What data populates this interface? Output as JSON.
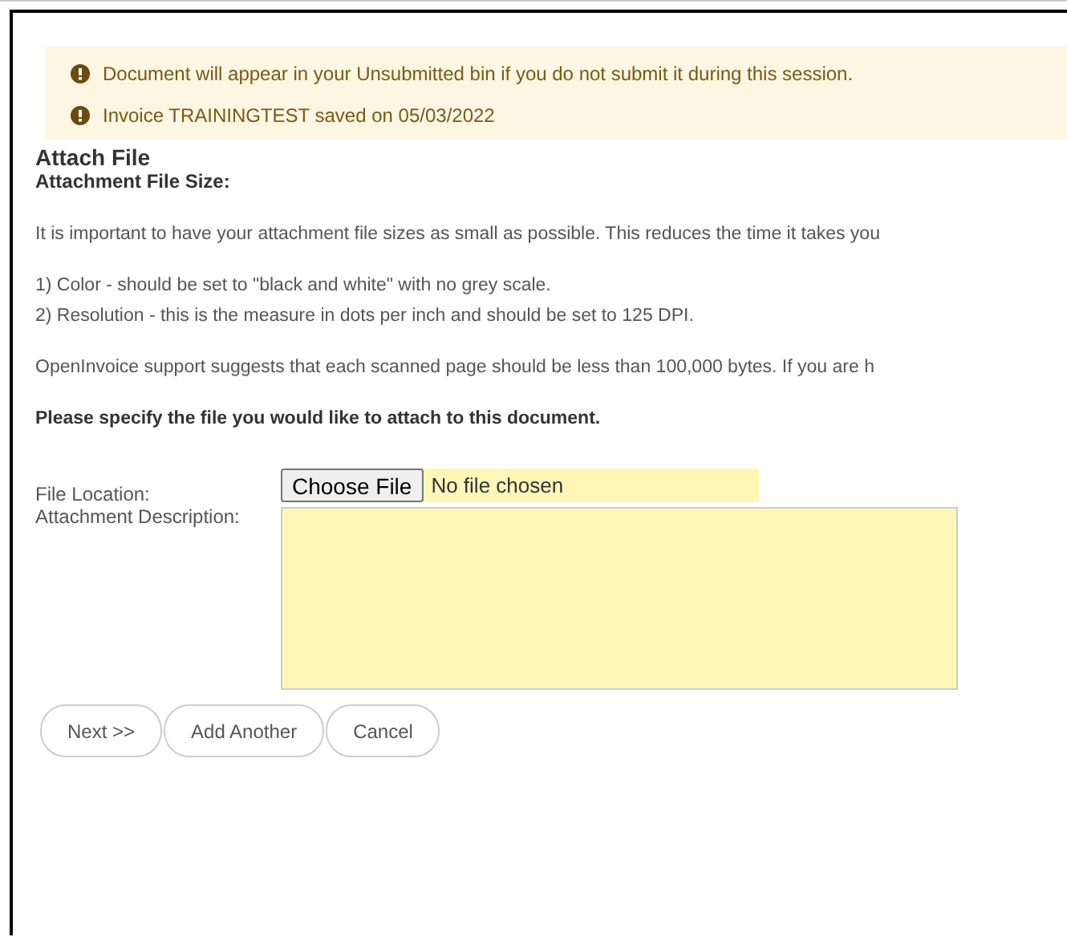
{
  "alerts": [
    "Document will appear in your Unsubmitted bin if you do not submit it during this session.",
    "Invoice TRAININGTEST saved on 05/03/2022"
  ],
  "title": "Attach File",
  "subtitle": "Attachment File Size:",
  "paragraphs": [
    {
      "kind": "text",
      "lines": [
        "It is important to have your attachment file sizes as small as possible. This reduces the time it takes you"
      ]
    },
    {
      "kind": "text",
      "lines": [
        "1) Color - should be set to \"black and white\" with no grey scale.",
        "2) Resolution - this is the measure in dots per inch and should be set to 125 DPI."
      ]
    },
    {
      "kind": "text",
      "lines": [
        "OpenInvoice support suggests that each scanned page should be less than 100,000 bytes. If you are h"
      ]
    },
    {
      "kind": "strong",
      "lines": [
        "Please specify the file you would like to attach to this document."
      ]
    }
  ],
  "form": {
    "file_label": "File Location:",
    "file_button": "Choose File",
    "file_status": "No file chosen",
    "description_label": "Attachment Description:"
  },
  "buttons": [
    "Next >>",
    "Add Another",
    "Cancel"
  ]
}
